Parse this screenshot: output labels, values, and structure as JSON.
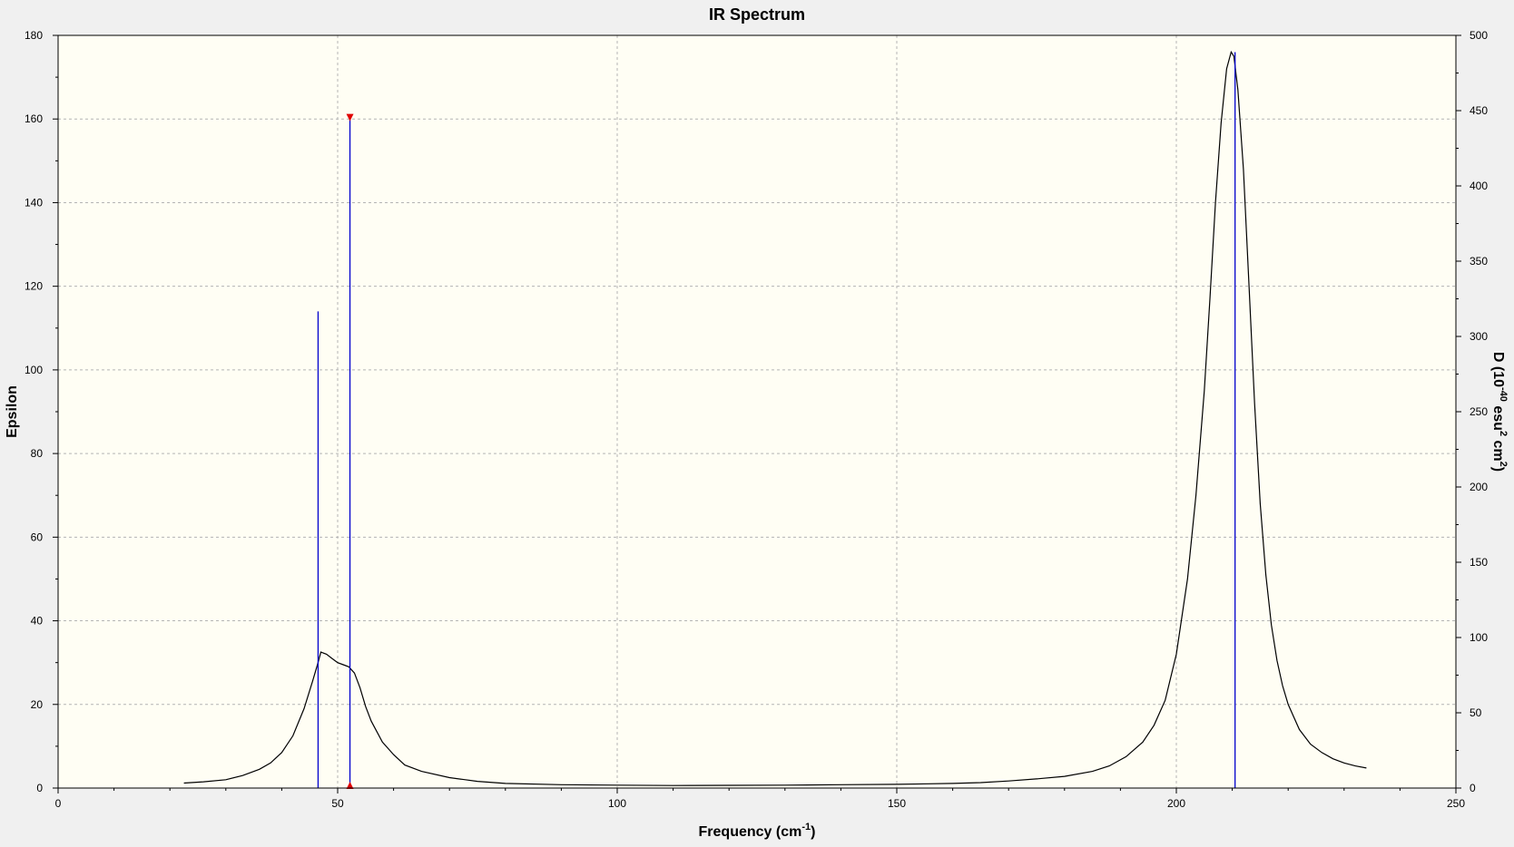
{
  "chart_data": {
    "type": "line",
    "title": "IR Spectrum",
    "xlabel": {
      "text": "Frequency (cm",
      "sup": "-1",
      "close": ")"
    },
    "ylabel": "Epsilon",
    "y2label": {
      "p1": "D (10",
      "sup1": "-40",
      "p2": " esu",
      "sup2": "2",
      "p3": " cm",
      "sup3": "2",
      "p4": ")"
    },
    "xlim": [
      0,
      250
    ],
    "ylim": [
      0,
      180
    ],
    "y2lim": [
      0,
      500
    ],
    "xticks": [
      0,
      50,
      100,
      150,
      200,
      250
    ],
    "yticks": [
      0,
      20,
      40,
      60,
      80,
      100,
      120,
      140,
      160,
      180
    ],
    "y2ticks": [
      0,
      50,
      100,
      150,
      200,
      250,
      300,
      350,
      400,
      450,
      500
    ],
    "xtick_labels": [
      "0",
      "50",
      "100",
      "150",
      "200",
      "250"
    ],
    "ytick_labels": [
      "0",
      "20",
      "40",
      "60",
      "80",
      "100",
      "120",
      "140",
      "160",
      "180"
    ],
    "y2tick_labels": [
      "0",
      "50",
      "100",
      "150",
      "200",
      "250",
      "300",
      "350",
      "400",
      "450",
      "500"
    ],
    "grid": true,
    "spectrum": {
      "x": [
        22.5,
        26,
        30,
        33,
        36,
        38,
        40,
        42,
        44,
        45.5,
        46.5,
        47,
        48,
        49,
        50,
        51,
        52,
        53,
        54,
        55,
        56,
        58,
        60,
        62,
        65,
        70,
        75,
        80,
        90,
        100,
        110,
        120,
        130,
        140,
        150,
        160,
        165,
        170,
        175,
        180,
        185,
        188,
        191,
        194,
        196,
        198,
        200,
        202,
        203.5,
        205,
        206,
        207,
        208,
        209,
        209.8,
        210.3,
        211,
        212,
        213,
        214,
        215,
        216,
        217,
        218,
        219,
        220,
        222,
        224,
        226,
        228,
        230,
        232,
        234
      ],
      "y": [
        1.2,
        1.5,
        2.0,
        3.0,
        4.5,
        6.0,
        8.5,
        12.5,
        19.0,
        25.5,
        30.0,
        32.5,
        32.0,
        31.0,
        30.0,
        29.5,
        29.0,
        27.5,
        24.0,
        19.5,
        16.0,
        11.0,
        8.0,
        5.5,
        4.0,
        2.5,
        1.6,
        1.1,
        0.8,
        0.7,
        0.6,
        0.65,
        0.7,
        0.8,
        0.9,
        1.1,
        1.3,
        1.7,
        2.2,
        2.8,
        4.0,
        5.3,
        7.5,
        11.0,
        15.0,
        21.0,
        32.0,
        50.0,
        70.0,
        95.0,
        117.0,
        140.0,
        159.0,
        172.0,
        176.0,
        175.0,
        167.0,
        148.0,
        120.0,
        92.0,
        68.0,
        51.0,
        39.0,
        30.5,
        24.5,
        20.0,
        14.0,
        10.5,
        8.5,
        7.0,
        6.0,
        5.3,
        4.8
      ]
    },
    "sticks": [
      {
        "x": 46.5,
        "epsilon": 114,
        "selected": false
      },
      {
        "x": 52.2,
        "epsilon": 161,
        "selected": true
      },
      {
        "x": 210.5,
        "epsilon": 176,
        "selected": false
      }
    ],
    "colors": {
      "background": "#f0f0f0",
      "plot_area": "#fffef4",
      "spectrum": "#000000",
      "sticks": "#0000cc",
      "marker": "#e00000",
      "grid": "#b4b4b4"
    }
  }
}
